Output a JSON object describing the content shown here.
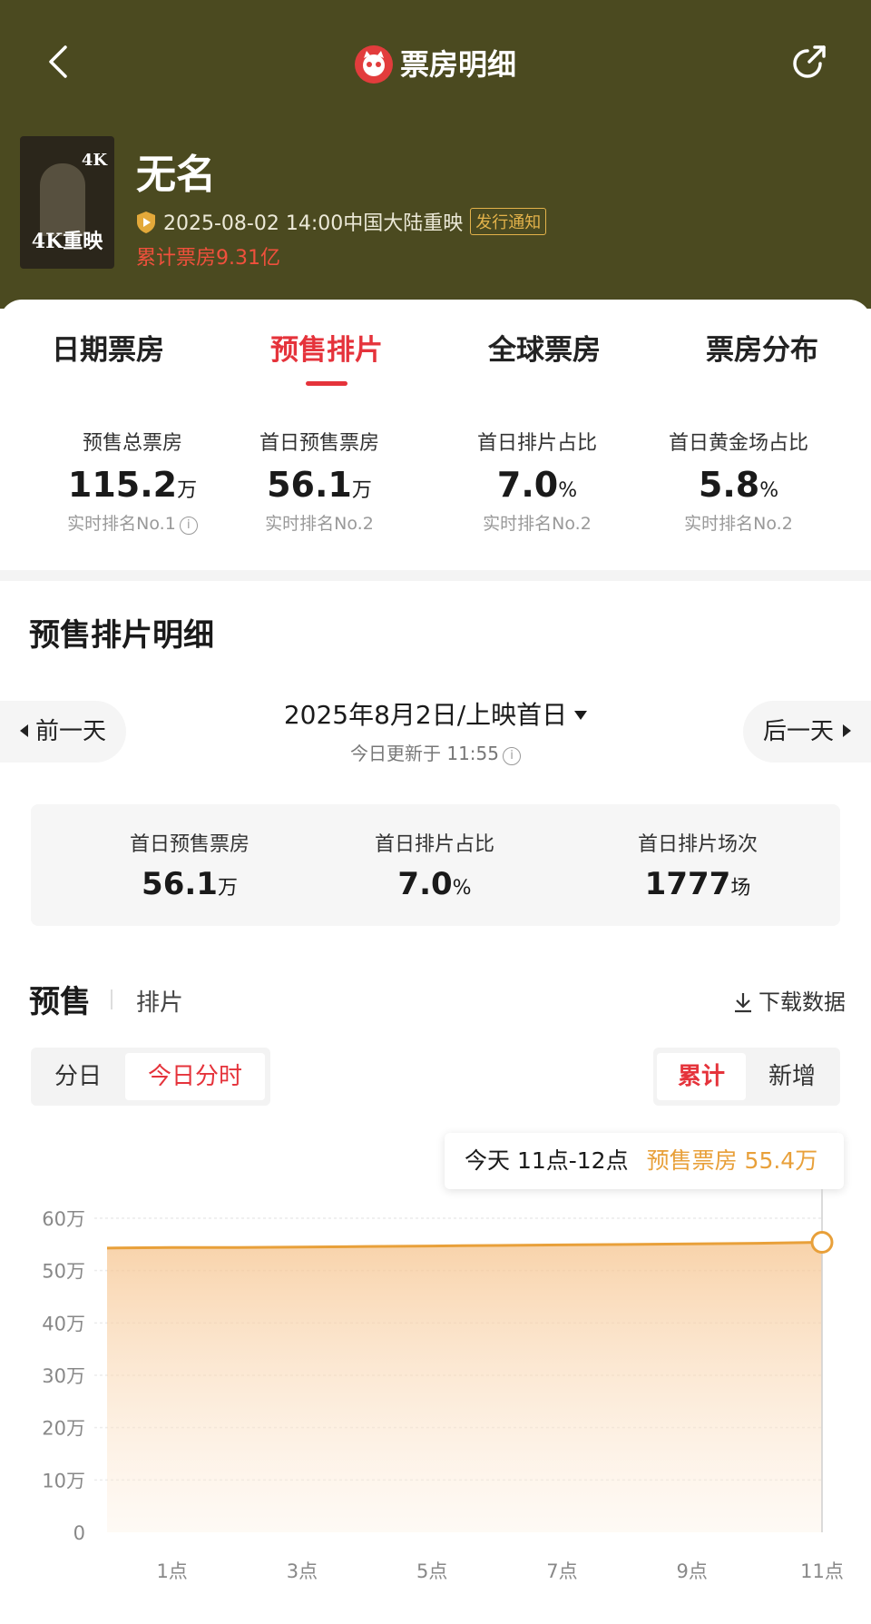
{
  "header": {
    "title": "票房明细",
    "movie_title": "无名",
    "release_info": "2025-08-02 14:00中国大陆重映",
    "notice_badge": "发行通知",
    "cumulative_box_office": "累计票房9.31亿",
    "poster_caption": "4K重映",
    "poster_mark": "4K",
    "colors": {
      "header_bg": "#4b4a20",
      "accent": "#e5333b"
    }
  },
  "tabs": [
    {
      "label": "日期票房",
      "active": false
    },
    {
      "label": "预售排片",
      "active": true
    },
    {
      "label": "全球票房",
      "active": false
    },
    {
      "label": "票房分布",
      "active": false
    }
  ],
  "stats": [
    {
      "label": "预售总票房",
      "value": "115.2",
      "unit": "万",
      "rank": "实时排名No.1"
    },
    {
      "label": "首日预售票房",
      "value": "56.1",
      "unit": "万",
      "rank": "实时排名No.2"
    },
    {
      "label": "首日排片占比",
      "value": "7.0",
      "unit": "%",
      "rank": "实时排名No.2"
    },
    {
      "label": "首日黄金场占比",
      "value": "5.8",
      "unit": "%",
      "rank": "实时排名No.2"
    }
  ],
  "section_title": "预售排片明细",
  "date_selector": {
    "prev": "前一天",
    "next": "后一天",
    "date": "2025年8月2日/上映首日",
    "updated": "今日更新于  11:55"
  },
  "summary": [
    {
      "label": "首日预售票房",
      "value": "56.1",
      "unit": "万"
    },
    {
      "label": "首日排片占比",
      "value": "7.0",
      "unit": "%"
    },
    {
      "label": "首日排片场次",
      "value": "1777",
      "unit": "场"
    }
  ],
  "chart_section": {
    "main_tab": "预售",
    "sub_tab": "排片",
    "download": "下载数据",
    "mode_options": [
      {
        "label": "分日",
        "selected": false
      },
      {
        "label": "今日分时",
        "selected": true
      }
    ],
    "value_options": [
      {
        "label": "累计",
        "selected": true
      },
      {
        "label": "新增",
        "selected": false
      }
    ],
    "tooltip_time": "今天 11点-12点",
    "tooltip_value": "预售票房 55.4万"
  },
  "chart_data": {
    "type": "area",
    "x": [
      0,
      1,
      2,
      3,
      4,
      5,
      6,
      7,
      8,
      9,
      10,
      11
    ],
    "xtick_values": [
      1,
      3,
      5,
      7,
      9,
      11
    ],
    "xtick_labels": [
      "1点",
      "3点",
      "5点",
      "7点",
      "9点",
      "11点"
    ],
    "y_ticks": [
      0,
      10,
      20,
      30,
      40,
      50,
      60
    ],
    "ytick_labels": [
      "0",
      "10万",
      "20万",
      "30万",
      "40万",
      "50万",
      "60万"
    ],
    "ylim": [
      0,
      60
    ],
    "xlim": [
      0,
      11
    ],
    "series": [
      {
        "values": [
          54.3,
          54.4,
          54.4,
          54.5,
          54.6,
          54.7,
          54.8,
          54.9,
          55.0,
          55.1,
          55.2,
          55.4
        ],
        "color": "#e8a03a"
      }
    ],
    "grid": true,
    "highlight_index": 11
  }
}
